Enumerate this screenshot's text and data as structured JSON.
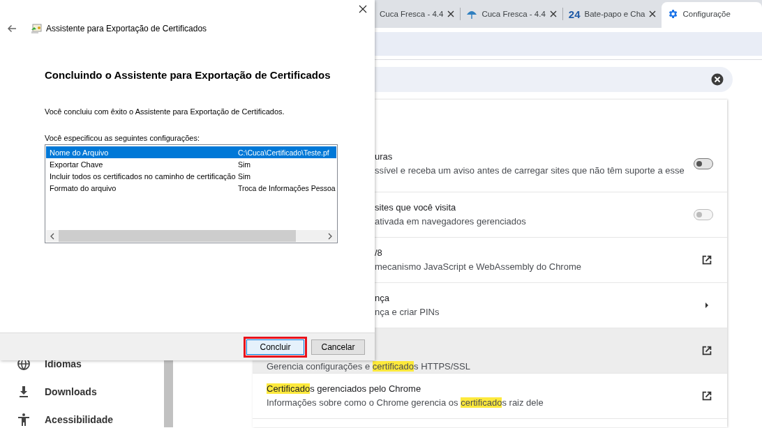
{
  "browser": {
    "tabs": [
      {
        "kind": "page",
        "title": "Cuca Fresca - 4.4",
        "selected": false
      },
      {
        "kind": "site",
        "title": "Cuca Fresca - 4.4",
        "selected": false
      },
      {
        "kind": "text-logo",
        "logo": "24",
        "title": "Bate-papo e Cha",
        "selected": false
      },
      {
        "kind": "settings",
        "title": "Configuraçõe",
        "selected": true
      }
    ],
    "sidebar": [
      {
        "label": "Idiomas",
        "kind": "globe"
      },
      {
        "label": "Downloads",
        "kind": "download"
      },
      {
        "label": "Acessibilidade",
        "kind": "accessibility"
      }
    ],
    "rows": [
      {
        "kind": "toggle",
        "on": false,
        "disabled": false,
        "lines": [
          [
            {
              "text": "uras",
              "highlight": false
            }
          ],
          [
            {
              "text": "ssível e receba um aviso antes de carregar sites que não têm suporte a esse",
              "highlight": false
            }
          ]
        ]
      },
      {
        "kind": "toggle",
        "on": false,
        "disabled": true,
        "lines": [
          [
            {
              "text": "sites que você visita",
              "highlight": false
            }
          ],
          [
            {
              "text": "ativada em navegadores gerenciados",
              "highlight": false
            }
          ]
        ]
      },
      {
        "kind": "external",
        "lines": [
          [
            {
              "text": "/8",
              "highlight": false
            }
          ],
          [
            {
              "text": "mecanismo JavaScript e WebAssembly do Chrome",
              "highlight": false
            }
          ]
        ]
      },
      {
        "kind": "submenu",
        "lines": [
          [
            {
              "text": "nça",
              "highlight": false
            }
          ],
          [
            {
              "text": "nça e criar PINs",
              "highlight": false
            }
          ]
        ]
      },
      {
        "kind": "external",
        "hovered": true,
        "lines": [
          [
            {
              "text": "Gerencia configurações e ",
              "highlight": false
            },
            {
              "text": "certificado",
              "highlight": true
            },
            {
              "text": "s HTTPS/SSL",
              "highlight": false
            }
          ]
        ]
      },
      {
        "kind": "external",
        "lines": [
          [
            {
              "text": "Certificado",
              "highlight": true
            },
            {
              "text": "s gerenciados pelo Chrome",
              "highlight": false
            }
          ],
          [
            {
              "text": "Informações sobre como o Chrome gerencia os ",
              "highlight": false
            },
            {
              "text": "certificado",
              "highlight": true
            },
            {
              "text": "s raiz dele",
              "highlight": false
            }
          ]
        ]
      }
    ]
  },
  "dialog": {
    "title": "Assistente para Exportação de Certificados",
    "heading": "Concluindo o Assistente para Exportação de Certificados",
    "message": "Você concluiu com êxito o Assistente para Exportação de Certificados.",
    "list_label": "Você especificou as seguintes configurações:",
    "settings": [
      {
        "name": "Nome do Arquivo",
        "value": "C:\\Cuca\\Certificado\\Teste.pf",
        "selected": true
      },
      {
        "name": "Exportar Chave",
        "value": "Sim",
        "selected": false
      },
      {
        "name": "Incluir todos os certificados no caminho de certificação",
        "value": "Sim",
        "selected": false
      },
      {
        "name": "Formato do arquivo",
        "value": "Troca de Informações Pessoa",
        "selected": false
      }
    ],
    "buttons": [
      {
        "label": "Concluir",
        "default": true,
        "annotated": true
      },
      {
        "label": "Cancelar",
        "default": false,
        "annotated": false
      }
    ]
  }
}
